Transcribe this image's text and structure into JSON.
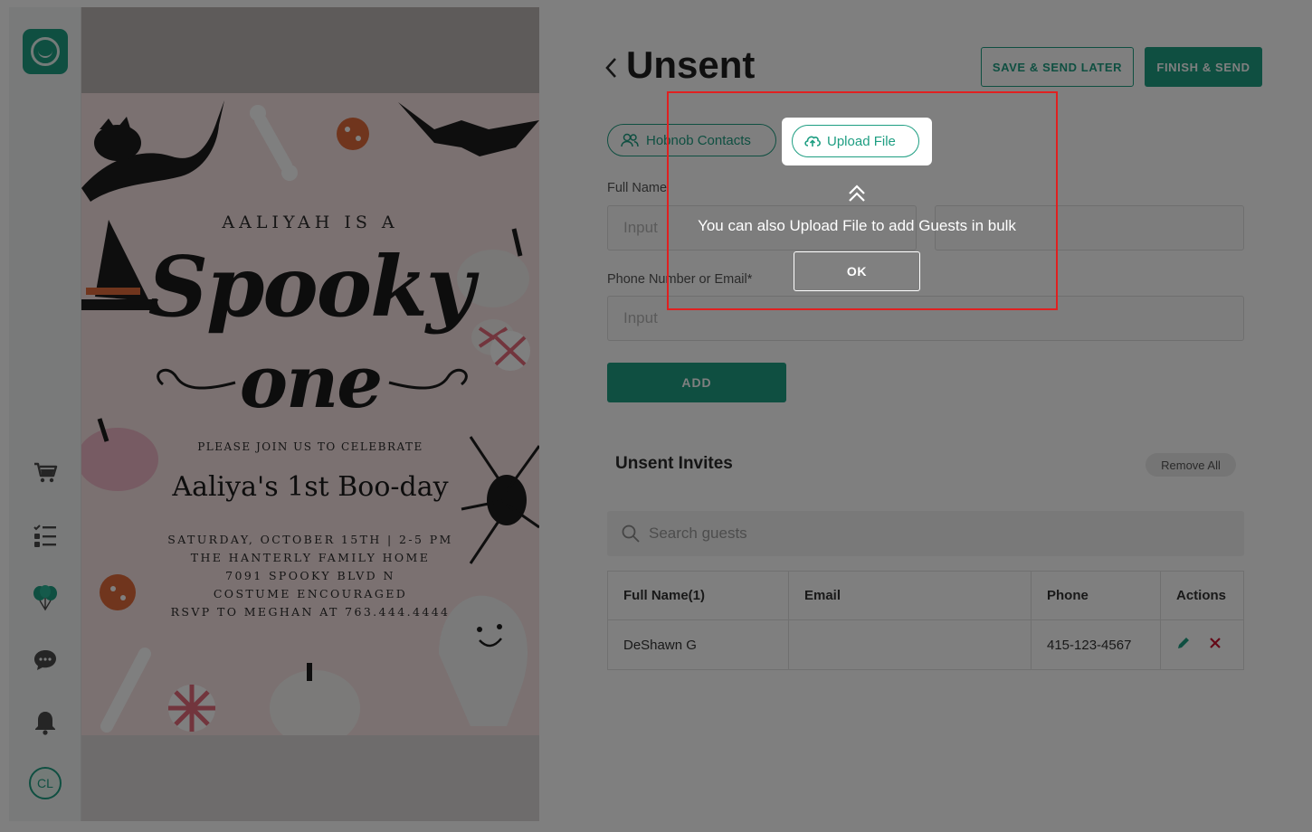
{
  "sidebar": {
    "logo_icon": "hobnob-logo-icon",
    "nav_icons": [
      "cart-icon",
      "checklist-icon",
      "balloons-icon",
      "chat-icon",
      "bell-icon"
    ],
    "avatar_initials": "CL"
  },
  "invitation": {
    "line1": "AALIYAH IS A",
    "script1": "Spooky",
    "script2": "one",
    "line2": "PLEASE JOIN US TO CELEBRATE",
    "line3": "Aaliya's 1st Boo-day",
    "details": [
      "SATURDAY, OCTOBER 15TH | 2-5 PM",
      "THE HANTERLY FAMILY HOME",
      "7091 SPOOKY BLVD N",
      "COSTUME ENCOURAGED",
      "RSVP TO MEGHAN AT 763.444.4444"
    ]
  },
  "header": {
    "title": "Unsent",
    "save_send_later": "SAVE & SEND LATER",
    "finish_send": "FINISH & SEND"
  },
  "source_tabs": {
    "contacts": "Hobnob Contacts",
    "upload": "Upload File"
  },
  "form": {
    "full_name_label": "Full Name",
    "first_placeholder": "Input",
    "phone_email_label": "Phone Number or Email*",
    "phone_placeholder": "Input",
    "add_label": "ADD"
  },
  "unsent": {
    "title": "Unsent Invites",
    "remove_all": "Remove All",
    "search_placeholder": "Search guests",
    "columns": [
      "Full Name(1)",
      "Email",
      "Phone",
      "Actions"
    ],
    "rows": [
      {
        "name": "DeShawn G",
        "email": "",
        "phone": "415-123-4567"
      }
    ]
  },
  "coach": {
    "message": "You can also Upload File to add Guests in bulk",
    "ok_label": "OK"
  },
  "colors": {
    "brand": "#1e9e82",
    "highlight_border": "#e02020"
  }
}
